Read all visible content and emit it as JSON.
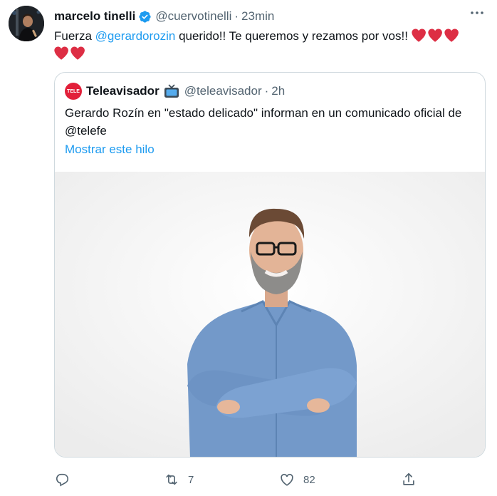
{
  "tweet": {
    "author_name": "marcelo tinelli",
    "author_handle": "@cuervotinelli",
    "separator": "·",
    "time": "23min",
    "text_before": "Fuerza ",
    "mention": "@gerardorozin",
    "text_after": " querido!! Te queremos y rezamos por vos!! ",
    "hearts_count": 5
  },
  "quoted": {
    "avatar_text": "TELE",
    "author_name": "Teleavisador",
    "author_handle": "@teleavisador",
    "separator": "·",
    "time": "2h",
    "text": "Gerardo Rozín en \"estado delicado\" informan en un comunicado oficial de @telefe",
    "thread_link": "Mostrar este hilo"
  },
  "actions": {
    "reply_count": "",
    "retweet_count": "7",
    "like_count": "82"
  },
  "colors": {
    "accent": "#1d9bf0",
    "secondary_text": "#536471",
    "border": "#cfd9de",
    "heart": "#e0245e"
  },
  "icons": [
    "verified-badge-icon",
    "more-options-icon",
    "red-heart-icon",
    "tv-icon",
    "reply-icon",
    "retweet-icon",
    "like-icon",
    "share-icon"
  ]
}
